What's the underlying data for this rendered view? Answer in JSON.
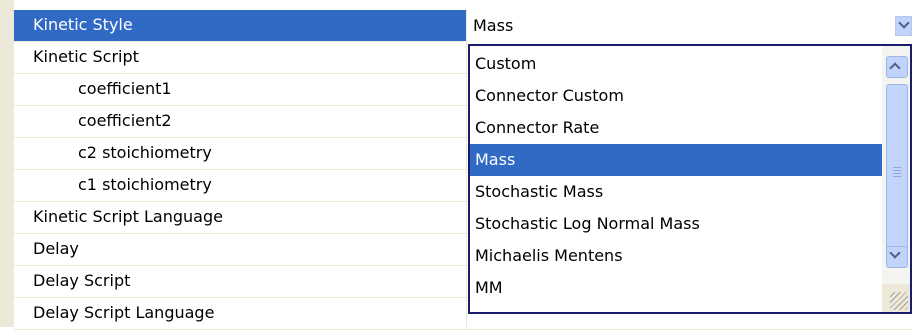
{
  "properties": [
    {
      "label": "Kinetic Style",
      "indent": false,
      "selected": true
    },
    {
      "label": "Kinetic Script",
      "indent": false,
      "expandable": true
    },
    {
      "label": "coefficient1",
      "indent": true
    },
    {
      "label": "coefficient2",
      "indent": true
    },
    {
      "label": "c2 stoichiometry",
      "indent": true
    },
    {
      "label": "c1 stoichiometry",
      "indent": true
    },
    {
      "label": "Kinetic Script Language",
      "indent": false
    },
    {
      "label": "Delay",
      "indent": false
    },
    {
      "label": "Delay Script",
      "indent": false
    },
    {
      "label": "Delay Script Language",
      "indent": false
    }
  ],
  "combo": {
    "value": "Mass",
    "arrow_icon": "chevron-down-icon"
  },
  "dropdown": {
    "options": [
      "Custom",
      "Connector Custom",
      "Connector Rate",
      "Mass",
      "Stochastic Mass",
      "Stochastic Log Normal Mass",
      "Michaelis Mentens",
      "MM"
    ],
    "selected_index": 3
  },
  "colors": {
    "selection": "#316ac5",
    "gutter": "#ece9d8",
    "dropdown_border": "#1c1c6c",
    "scroll_button": "#c1d3fb"
  }
}
